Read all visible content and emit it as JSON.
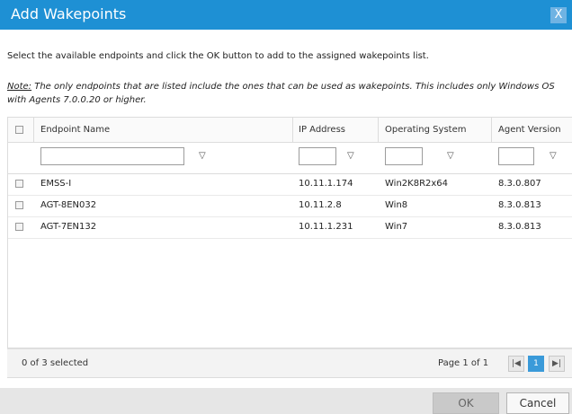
{
  "dialog": {
    "title": "Add Wakepoints",
    "close_glyph": "X",
    "instructions": "Select the available endpoints and click the OK button to add to the assigned wakepoints list.",
    "note_label": "Note:",
    "note_text": " The only endpoints that are listed include the ones that can be used as wakepoints. This includes only Windows OS with Agents 7.0.0.20 or higher."
  },
  "table": {
    "columns": [
      {
        "key": "name",
        "label": "Endpoint Name"
      },
      {
        "key": "ip",
        "label": "IP Address"
      },
      {
        "key": "os",
        "label": "Operating System"
      },
      {
        "key": "agent",
        "label": "Agent Version"
      }
    ],
    "filters": {
      "name": "",
      "ip": "",
      "os": "",
      "agent": ""
    },
    "rows": [
      {
        "name": "EMSS-I",
        "ip": "10.11.1.174",
        "os": "Win2K8R2x64",
        "agent": "8.3.0.807",
        "checked": false
      },
      {
        "name": "AGT-8EN032",
        "ip": "10.11.2.8",
        "os": "Win8",
        "agent": "8.3.0.813",
        "checked": false
      },
      {
        "name": "AGT-7EN132",
        "ip": "10.11.1.231",
        "os": "Win7",
        "agent": "8.3.0.813",
        "checked": false
      }
    ]
  },
  "footer": {
    "selected_text": "0 of 3 selected",
    "page_info": "Page 1 of 1",
    "first_glyph": "|◀",
    "current_page": "1",
    "last_glyph": "▶|"
  },
  "buttons": {
    "ok": "OK",
    "cancel": "Cancel"
  },
  "icons": {
    "filter": "funnel-icon",
    "close": "close-icon",
    "first": "first-page-icon",
    "last": "last-page-icon"
  },
  "colors": {
    "titlebar": "#1e90d4",
    "current_page": "#3a9ad9"
  }
}
